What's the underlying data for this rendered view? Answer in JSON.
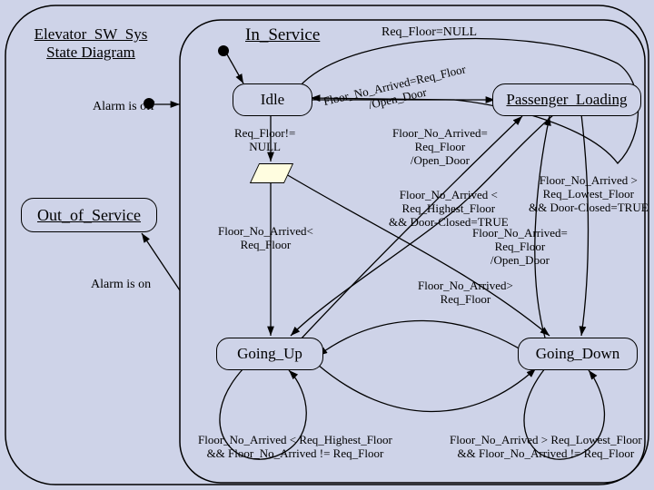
{
  "diagram": {
    "title_line1": "Elevator_SW_Sys",
    "title_line2": "State Diagram",
    "alarm_off": "Alarm is off",
    "alarm_on": "Alarm is on",
    "states": {
      "in_service": "In_Service",
      "idle": "Idle",
      "out_of_service": "Out_of_Service",
      "passenger_loading": "Passenger_Loading",
      "going_up": "Going_Up",
      "going_down": "Going_Down"
    },
    "transitions": {
      "req_floor_null": "Req_Floor=NULL",
      "req_floor_not_null_l1": "Req_Floor!=",
      "req_floor_not_null_l2": "NULL",
      "arrived_eq_open_l1": "Floor_No_Arrived=Req_Floor",
      "arrived_eq_open_l2": "/Open_Door",
      "arrived_eq_open2_l1": "Floor_No_Arrived=",
      "arrived_eq_open2_l2": "Req_Floor",
      "arrived_eq_open2_l3": "/Open_Door",
      "arrived_eq_open3_l1": "Floor_No_Arrived=",
      "arrived_eq_open3_l2": "Req_Floor",
      "arrived_eq_open3_l3": "/Open_Door",
      "arrived_lt_l1": "Floor_No_Arrived<",
      "arrived_lt_l2": "Req_Floor",
      "arrived_gt_l1": "Floor_No_Arrived>",
      "arrived_gt_l2": "Req_Floor",
      "lt_highest_closed_l1": "Floor_No_Arrived <",
      "lt_highest_closed_l2": "Req_Highest_Floor",
      "lt_highest_closed_l3": "&& Door-Closed=TRUE",
      "gt_lowest_closed_l1": "Floor_No_Arrived >",
      "gt_lowest_closed_l2": "Req_Lowest_Floor",
      "gt_lowest_closed_l3": "&& Door-Closed=TRUE",
      "lt_highest_ne_l1": "Floor_No_Arrived < Req_Highest_Floor",
      "lt_highest_ne_l2": "&& Floor_No_Arrived != Req_Floor",
      "gt_lowest_ne_l1": "Floor_No_Arrived > Req_Lowest_Floor",
      "gt_lowest_ne_l2": "&& Floor_No_Arrived != Req_Floor"
    }
  }
}
